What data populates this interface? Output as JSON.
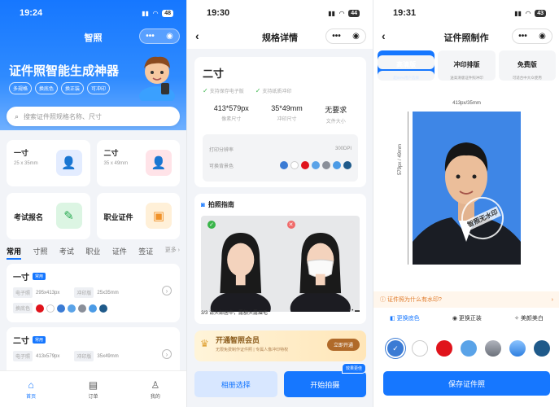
{
  "p1": {
    "time": "19:24",
    "battery": "48",
    "nav_title": "智照",
    "hero_title": "证件照智能生成神器",
    "tags": [
      "多规格",
      "换底色",
      "换正装",
      "可冲印"
    ],
    "search_placeholder": "搜索证件照规格名称、尺寸",
    "cards": [
      {
        "title": "一寸",
        "sub": "25 x 35mm"
      },
      {
        "title": "二寸",
        "sub": "35 x 49mm"
      },
      {
        "title": "考试报名",
        "sub": ""
      },
      {
        "title": "职业证件",
        "sub": ""
      }
    ],
    "tabs": [
      "常用",
      "寸照",
      "考试",
      "职业",
      "证件",
      "签证",
      "更多"
    ],
    "list": [
      {
        "title": "一寸",
        "badge": "常用",
        "e_label": "电子照",
        "e_val": "295x413px",
        "p_label": "冲印版",
        "p_val": "25x35mm",
        "bg_label": "换底色"
      },
      {
        "title": "二寸",
        "badge": "常用",
        "e_label": "电子照",
        "e_val": "413x579px",
        "p_label": "冲印版",
        "p_val": "35x49mm"
      }
    ],
    "tabbar": [
      "首页",
      "订单",
      "我的"
    ]
  },
  "p2": {
    "time": "19:30",
    "battery": "44",
    "nav_title": "规格详情",
    "name": "二寸",
    "check1": "支持保存电子版",
    "check2": "支持纸质冲印",
    "vals": [
      {
        "v": "413*579px",
        "l": "像素尺寸"
      },
      {
        "v": "35*49mm",
        "l": "冲印尺寸"
      },
      {
        "v": "无要求",
        "l": "文件大小"
      }
    ],
    "dpi_label": "打印分辨率",
    "dpi_val": "300DPI",
    "bg_label": "可换背景色",
    "guide_title": "拍照指南",
    "guide_note": "3/3 请头部居中，露额头露眉毛",
    "vip_title": "开通智照会员",
    "vip_sub": "无限免费制作证件照 | 专属人像冲印特权",
    "vip_btn": "立即开通",
    "btn_album": "相册选择",
    "btn_shoot": "开始拍摄",
    "tip": "效果更佳"
  },
  "p3": {
    "time": "19:31",
    "battery": "43",
    "nav_title": "证件照制作",
    "q": [
      {
        "t": "高清版",
        "d": "超99%用户选择"
      },
      {
        "t": "冲印排版",
        "d": "送高清版证件照冲印"
      },
      {
        "t": "免费版",
        "d": "可适合中大众使用"
      }
    ],
    "dim_w": "413px/35mm",
    "dim_h": "579px / 49mm",
    "stamp": "智照无水印",
    "wm_text": "证件照为什么有水印?",
    "tools": [
      "更换底色",
      "更换正装",
      "美颜美白"
    ],
    "save": "保存证件照"
  },
  "colors": {
    "primary": "#1677ff",
    "swatches": [
      "#3b7bd4",
      "#ffffff",
      "#e0131b",
      "#5aa3e8",
      "#8a8f99",
      "#4b9be6",
      "#1f5a8a"
    ]
  }
}
